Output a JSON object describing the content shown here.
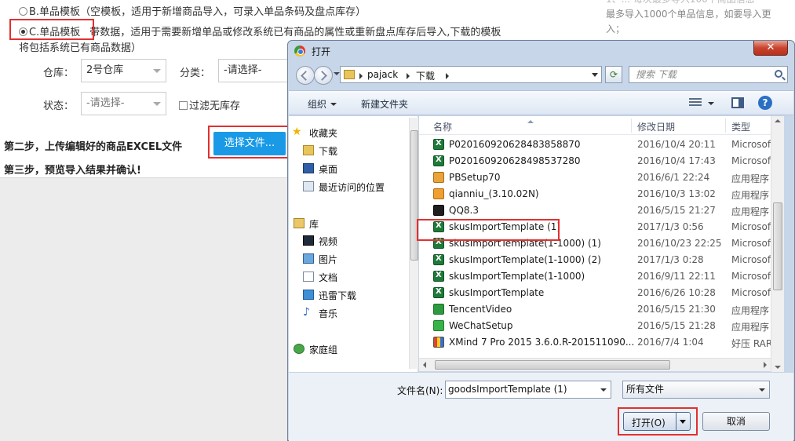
{
  "page": {
    "option_b": {
      "label": "B.单品模板",
      "desc": "（空模板，适用于新增商品导入，可录入单品条码及盘点库存）"
    },
    "option_c": {
      "label": "C.单品模板",
      "desc": "带数据，适用于需要新增单品或修改系统已有商品的属性或重新盘点库存后导入,下载的模板",
      "desc2": "将包括系统已有商品数据）"
    },
    "warehouse_label": "仓库：",
    "warehouse_value": "2号仓库",
    "category_label": "分类：",
    "category_value": "-请选择-",
    "status_label": "状态：",
    "status_value": "-请选择-",
    "filter_label": "过滤无库存",
    "step2_label": "第二步，上传编辑好的商品EXCEL文件",
    "choose_file_button": "选择文件...",
    "step3_label": "第三步，预览导入结果并确认!",
    "side_note_line1": "1、... 每次最多导入100个商品信息",
    "side_note_line2": "最多导入1000个单品信息，如要导入更",
    "side_note_line3": "入；"
  },
  "dialog": {
    "title": "打开",
    "close_label": "✕",
    "breadcrumb": [
      "pajack",
      "下载"
    ],
    "search_placeholder": "搜索 下载",
    "toolbar": {
      "organize": "组织",
      "new_folder": "新建文件夹"
    },
    "nav": {
      "favorites": "收藏夹",
      "downloads": "下载",
      "desktop": "桌面",
      "recent": "最近访问的位置",
      "libraries": "库",
      "videos": "视频",
      "pictures": "图片",
      "documents": "文档",
      "xunlei": "迅雷下载",
      "music": "音乐",
      "homegroup": "家庭组"
    },
    "columns": {
      "name": "名称",
      "date": "修改日期",
      "type": "类型"
    },
    "files": [
      {
        "name": "P020160920628483858870",
        "date": "2016/10/4 20:11",
        "type": "Microsof",
        "icon": "excel-icon"
      },
      {
        "name": "P020160920628498537280",
        "date": "2016/10/4 17:43",
        "type": "Microsof",
        "icon": "excel-icon"
      },
      {
        "name": "PBSetup70",
        "date": "2016/6/1 22:24",
        "type": "应用程序",
        "icon": "app-icon"
      },
      {
        "name": "qianniu_(3.10.02N)",
        "date": "2016/10/3 13:02",
        "type": "应用程序",
        "icon": "app-icon"
      },
      {
        "name": "QQ8.3",
        "date": "2016/5/15 21:27",
        "type": "应用程序",
        "icon": "app-icon"
      },
      {
        "name": "skusImportTemplate (1)",
        "date": "2017/1/3 0:56",
        "type": "Microsof",
        "icon": "excel-icon"
      },
      {
        "name": "skusImportTemplate(1-1000) (1)",
        "date": "2016/10/23 22:25",
        "type": "Microsof",
        "icon": "excel-icon"
      },
      {
        "name": "skusImportTemplate(1-1000) (2)",
        "date": "2017/1/3 0:28",
        "type": "Microsof",
        "icon": "excel-icon"
      },
      {
        "name": "skusImportTemplate(1-1000)",
        "date": "2016/9/11 22:11",
        "type": "Microsof",
        "icon": "excel-icon"
      },
      {
        "name": "skusImportTemplate",
        "date": "2016/6/26 10:28",
        "type": "Microsof",
        "icon": "excel-icon"
      },
      {
        "name": "TencentVideo",
        "date": "2016/5/15 21:30",
        "type": "应用程序",
        "icon": "app-icon"
      },
      {
        "name": "WeChatSetup",
        "date": "2016/5/15 21:28",
        "type": "应用程序",
        "icon": "app-icon"
      },
      {
        "name": "XMind 7 Pro 2015 3.6.0.R-201511090...",
        "date": "2016/7/4 1:04",
        "type": "好压 RAR",
        "icon": "archive-icon"
      }
    ],
    "filename_label": "文件名(N):",
    "filename_value": "goodsImportTemplate (1)",
    "filetype_value": "所有文件",
    "open_button": "打开(O)",
    "cancel_button": "取消"
  },
  "colors": {
    "highlight": "#e23030",
    "primary_button": "#1a9ae6"
  }
}
